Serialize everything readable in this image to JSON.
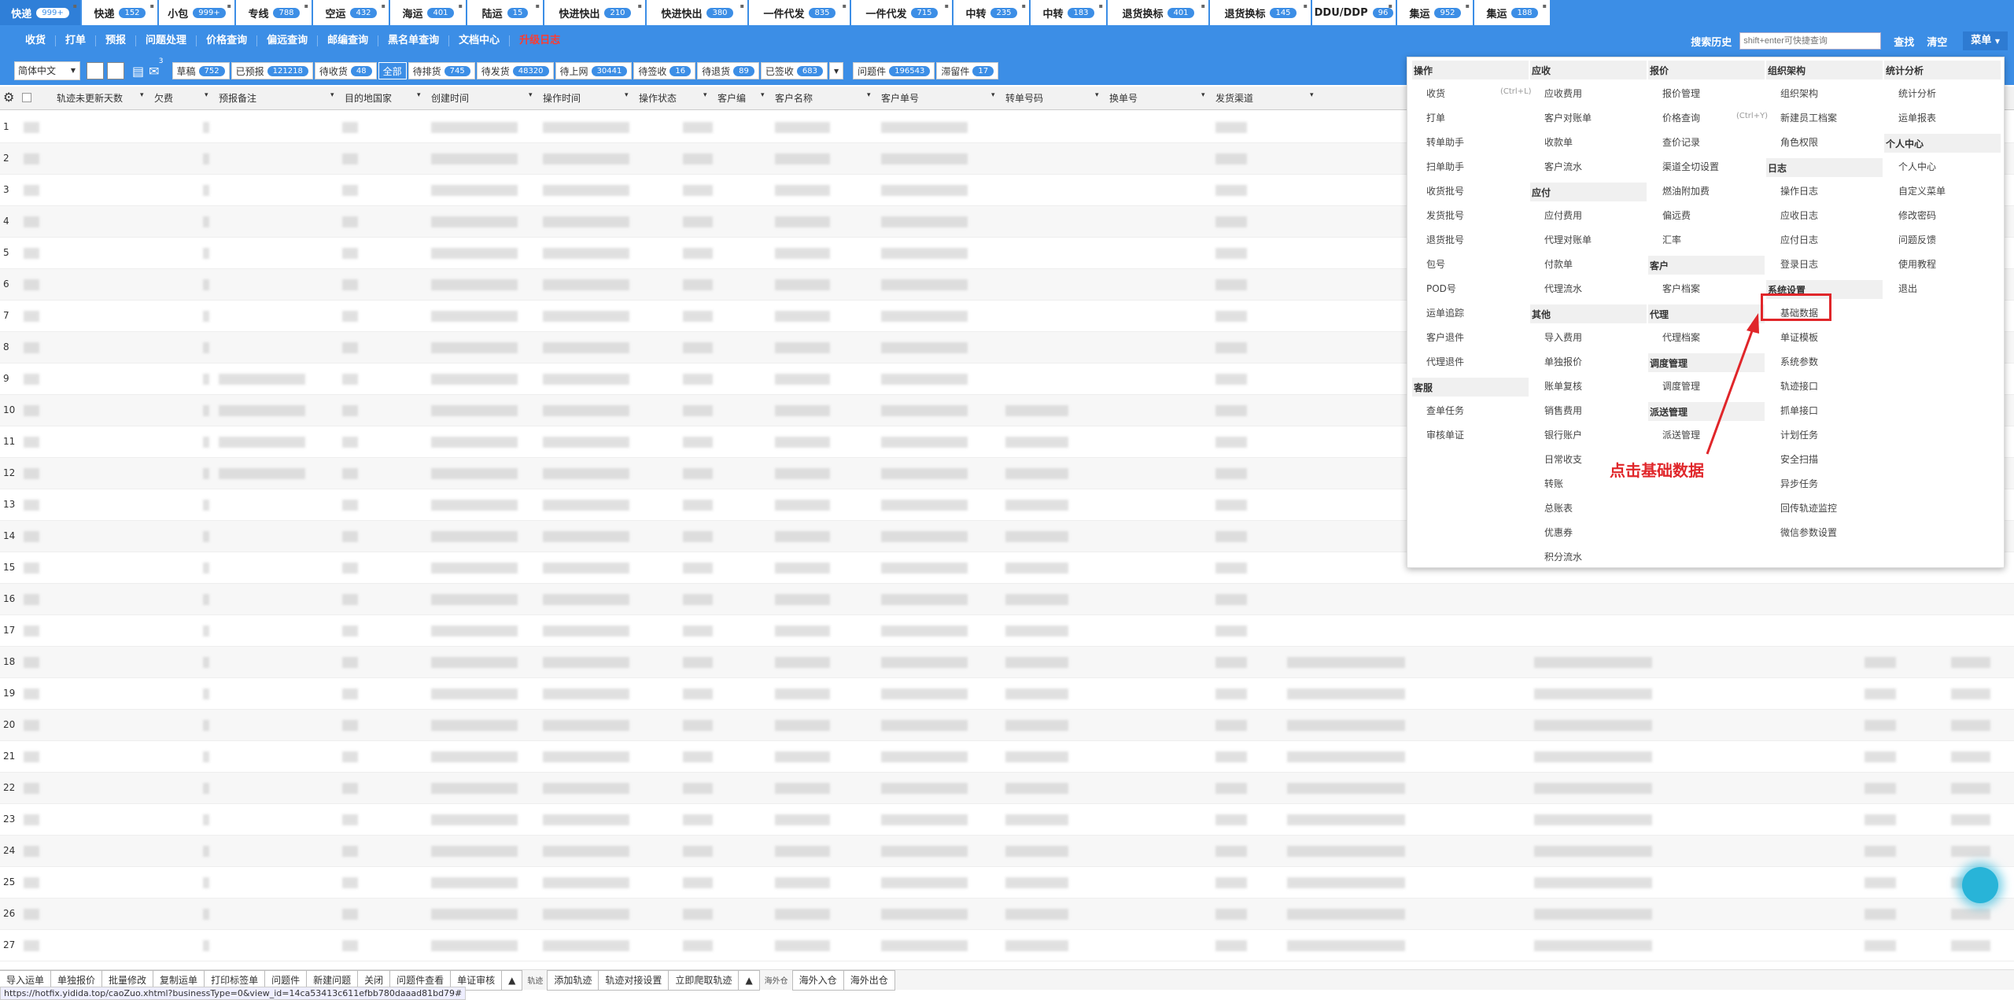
{
  "tabs": [
    {
      "label": "快递",
      "badge": "999+",
      "active": true
    },
    {
      "label": "快递",
      "badge": "152"
    },
    {
      "label": "小包",
      "badge": "999+"
    },
    {
      "label": "专线",
      "badge": "788"
    },
    {
      "label": "空运",
      "badge": "432"
    },
    {
      "label": "海运",
      "badge": "401"
    },
    {
      "label": "陆运",
      "badge": "15"
    },
    {
      "label": "快进快出",
      "badge": "210"
    },
    {
      "label": "快进快出",
      "badge": "380"
    },
    {
      "label": "一件代发",
      "badge": "835"
    },
    {
      "label": "一件代发",
      "badge": "715"
    },
    {
      "label": "中转",
      "badge": "235"
    },
    {
      "label": "中转",
      "badge": "183"
    },
    {
      "label": "退货换标",
      "badge": "401"
    },
    {
      "label": "退货换标",
      "badge": "145"
    },
    {
      "label": "DDU/DDP",
      "badge": "96"
    },
    {
      "label": "集运",
      "badge": "952"
    },
    {
      "label": "集运",
      "badge": "188"
    }
  ],
  "nav": {
    "items": [
      "收货",
      "打单",
      "预报",
      "问题处理",
      "价格查询",
      "偏远查询",
      "邮编查询",
      "黑名单查询",
      "文档中心",
      "升级日志"
    ],
    "search_history": "搜索历史",
    "search_placeholder": "shift+enter可快捷查询",
    "search_btn": "查找",
    "clear_btn": "清空",
    "menu_btn": "菜单"
  },
  "filter": {
    "language": "简体中文",
    "buttons": [
      {
        "label": "草稿",
        "badge": "752"
      },
      {
        "label": "已预报",
        "badge": "121218"
      },
      {
        "label": "待收货",
        "badge": "48"
      },
      {
        "label": "全部",
        "badge": "",
        "sel": true
      },
      {
        "label": "待排货",
        "badge": "745"
      },
      {
        "label": "待发货",
        "badge": "48320"
      },
      {
        "label": "待上网",
        "badge": "30441"
      },
      {
        "label": "待签收",
        "badge": "16"
      },
      {
        "label": "待退货",
        "badge": "89"
      },
      {
        "label": "已签收",
        "badge": "683"
      }
    ],
    "buttons2": [
      {
        "label": "问题件",
        "badge": "196543"
      },
      {
        "label": "滞留件",
        "badge": "17"
      }
    ],
    "mail_count": "3"
  },
  "grid": {
    "columns": [
      "轨迹未更新天数",
      "欠费",
      "预报备注",
      "目的地国家",
      "创建时间",
      "操作时间",
      "操作状态",
      "客户编",
      "客户名称",
      "客户单号",
      "转单号码",
      "换单号",
      "发货渠道"
    ],
    "rows": [
      "1",
      "2",
      "3",
      "4",
      "5",
      "6",
      "7",
      "8",
      "9",
      "10",
      "11",
      "12",
      "13",
      "14",
      "15",
      "16",
      "17",
      "18",
      "19",
      "20",
      "21",
      "22",
      "23",
      "24",
      "25",
      "26",
      "27"
    ]
  },
  "dropdown": {
    "col1": {
      "sections": [
        {
          "title": "操作",
          "items": [
            "收货",
            "打单",
            "转单助手",
            "扫单助手",
            "收货批号",
            "发货批号",
            "退货批号",
            "包号",
            "POD号",
            "运单追踪",
            "客户退件",
            "代理退件"
          ]
        },
        {
          "title": "客服",
          "items": [
            "查单任务",
            "审核单证"
          ]
        }
      ],
      "shortcut": "(Ctrl+L)"
    },
    "col2": {
      "sections": [
        {
          "title": "应收",
          "items": [
            "应收费用",
            "客户对账单",
            "收款单",
            "客户流水"
          ]
        },
        {
          "title": "应付",
          "items": [
            "应付费用",
            "代理对账单",
            "付款单",
            "代理流水"
          ]
        },
        {
          "title": "其他",
          "items": [
            "导入费用",
            "单独报价",
            "账单复核",
            "销售费用",
            "银行账户",
            "日常收支",
            "转账",
            "总账表",
            "优惠券",
            "积分流水"
          ]
        }
      ]
    },
    "col3": {
      "sections": [
        {
          "title": "报价",
          "items": [
            "报价管理",
            "价格查询",
            "查价记录",
            "渠道全切设置",
            "燃油附加费",
            "偏远费",
            "汇率"
          ]
        },
        {
          "title": "客户",
          "items": [
            "客户档案"
          ]
        },
        {
          "title": "代理",
          "items": [
            "代理档案"
          ]
        },
        {
          "title": "调度管理",
          "items": [
            "调度管理"
          ]
        },
        {
          "title": "派送管理",
          "items": [
            "派送管理"
          ]
        }
      ],
      "shortcut": "(Ctrl+Y)"
    },
    "col4": {
      "sections": [
        {
          "title": "组织架构",
          "items": [
            "组织架构",
            "新建员工档案",
            "角色权限"
          ]
        },
        {
          "title": "日志",
          "items": [
            "操作日志",
            "应收日志",
            "应付日志",
            "登录日志"
          ]
        },
        {
          "title": "系统设置",
          "items": [
            "基础数据",
            "单证模板",
            "系统参数",
            "轨迹接口",
            "抓单接口",
            "计划任务",
            "安全扫描",
            "异步任务",
            "回传轨迹监控",
            "微信参数设置"
          ]
        }
      ]
    },
    "col5": {
      "sections": [
        {
          "title": "统计分析",
          "items": [
            "统计分析",
            "运单报表"
          ]
        },
        {
          "title": "个人中心",
          "items": [
            "个人中心",
            "自定义菜单",
            "修改密码",
            "问题反馈",
            "使用教程",
            "退出"
          ]
        }
      ]
    }
  },
  "annotation": "点击基础数据",
  "bottom": {
    "left_buttons": [
      "导入运单",
      "单独报价",
      "批量修改",
      "复制运单",
      "打印标签单",
      "问题件",
      "新建问题",
      "关闭",
      "问题件查看",
      "单证审核"
    ],
    "label1": "轨迹",
    "mid_buttons": [
      "添加轨迹",
      "轨迹对接设置",
      "立即爬取轨迹"
    ],
    "label2": "海外仓",
    "right_buttons": [
      "海外入仓",
      "海外出仓"
    ]
  },
  "status_url": "https://hotfix.yidida.top/caoZuo.xhtml?businessType=0&view_id=14ca53413c611efbb780daaad81bd79#"
}
